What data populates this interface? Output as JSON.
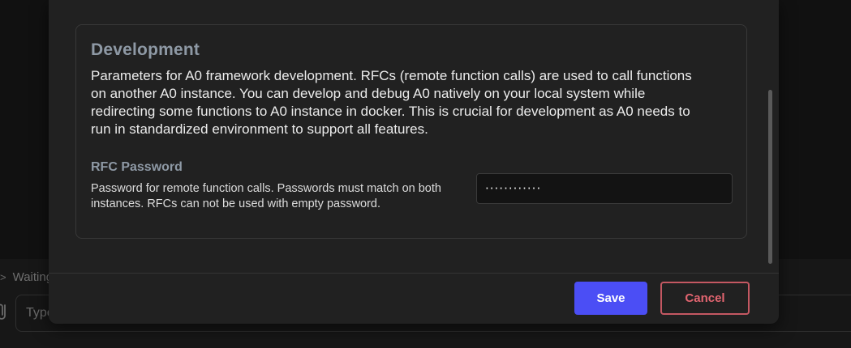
{
  "background": {
    "status_text": "Waiting for input",
    "status_chevron": ">",
    "chat_placeholder": "Type your message here..."
  },
  "modal": {
    "section": {
      "title": "Development",
      "description": "Parameters for A0 framework development. RFCs (remote function calls) are used to call functions on another A0 instance. You can develop and debug A0 natively on your local system while redirecting some functions to A0 instance in docker. This is crucial for development as A0 needs to run in standardized environment to support all features.",
      "fields": [
        {
          "title": "RFC Password",
          "description": "Password for remote function calls. Passwords must match on both instances. RFCs can not be used with empty password.",
          "value": "············",
          "type": "password"
        }
      ]
    },
    "footer": {
      "save_label": "Save",
      "cancel_label": "Cancel"
    }
  },
  "colors": {
    "accent": "#4b4ef5",
    "danger": "#c45862",
    "heading": "#8e99a5"
  }
}
